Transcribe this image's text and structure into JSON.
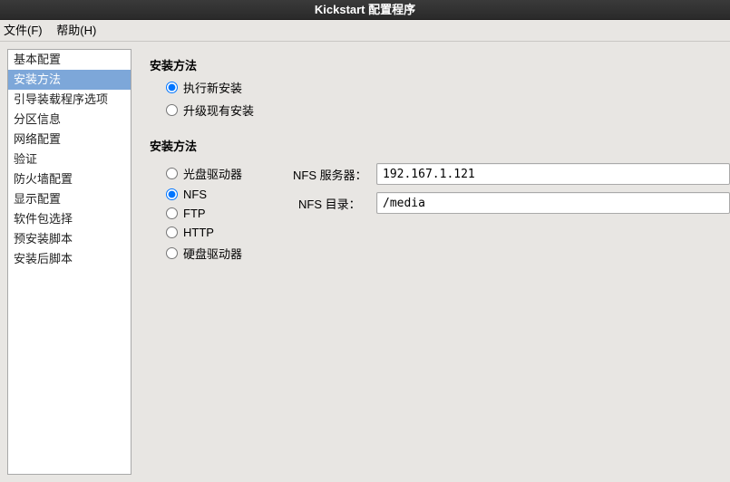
{
  "window": {
    "title": "Kickstart 配置程序"
  },
  "menubar": {
    "file": "文件(F)",
    "help": "帮助(H)"
  },
  "sidebar": {
    "items": [
      {
        "label": "基本配置",
        "selected": false
      },
      {
        "label": "安装方法",
        "selected": true
      },
      {
        "label": "引导装载程序选项",
        "selected": false
      },
      {
        "label": "分区信息",
        "selected": false
      },
      {
        "label": "网络配置",
        "selected": false
      },
      {
        "label": "验证",
        "selected": false
      },
      {
        "label": "防火墙配置",
        "selected": false
      },
      {
        "label": "显示配置",
        "selected": false
      },
      {
        "label": "软件包选择",
        "selected": false
      },
      {
        "label": "预安装脚本",
        "selected": false
      },
      {
        "label": "安装后脚本",
        "selected": false
      }
    ]
  },
  "main": {
    "mode_title": "安装方法",
    "mode_new": "执行新安装",
    "mode_upgrade": "升级现有安装",
    "method_title": "安装方法",
    "method_cd": "光盘驱动器",
    "method_nfs": "NFS",
    "method_ftp": "FTP",
    "method_http": "HTTP",
    "method_hd": "硬盘驱动器",
    "nfs_server_label": "NFS 服务器：",
    "nfs_server_value": "192.167.1.121",
    "nfs_dir_label": "NFS 目录：",
    "nfs_dir_value": "/media"
  }
}
